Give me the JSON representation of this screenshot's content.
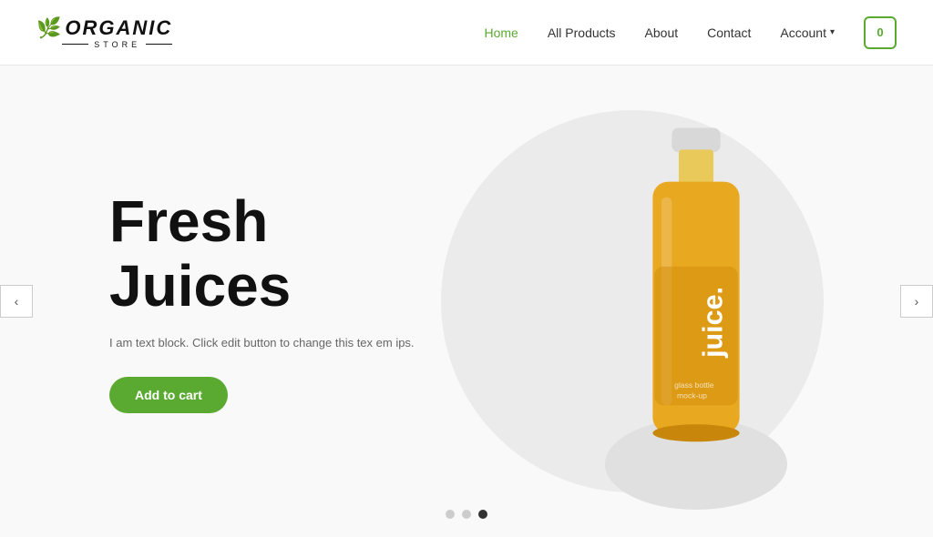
{
  "header": {
    "logo": {
      "organic_text": "ORGANIC",
      "store_text": "STORE",
      "leaf_icon": "🌿"
    },
    "nav": {
      "home_label": "Home",
      "products_label": "All Products",
      "about_label": "About",
      "contact_label": "Contact",
      "account_label": "Account",
      "cart_count": "0"
    }
  },
  "hero": {
    "title": "Fresh Juices",
    "subtitle": "I am text block. Click edit button to change this tex em ips.",
    "cta_label": "Add to cart",
    "prev_arrow": "‹",
    "next_arrow": "›",
    "dots": [
      {
        "id": 1,
        "active": false
      },
      {
        "id": 2,
        "active": false
      },
      {
        "id": 3,
        "active": true
      }
    ]
  }
}
